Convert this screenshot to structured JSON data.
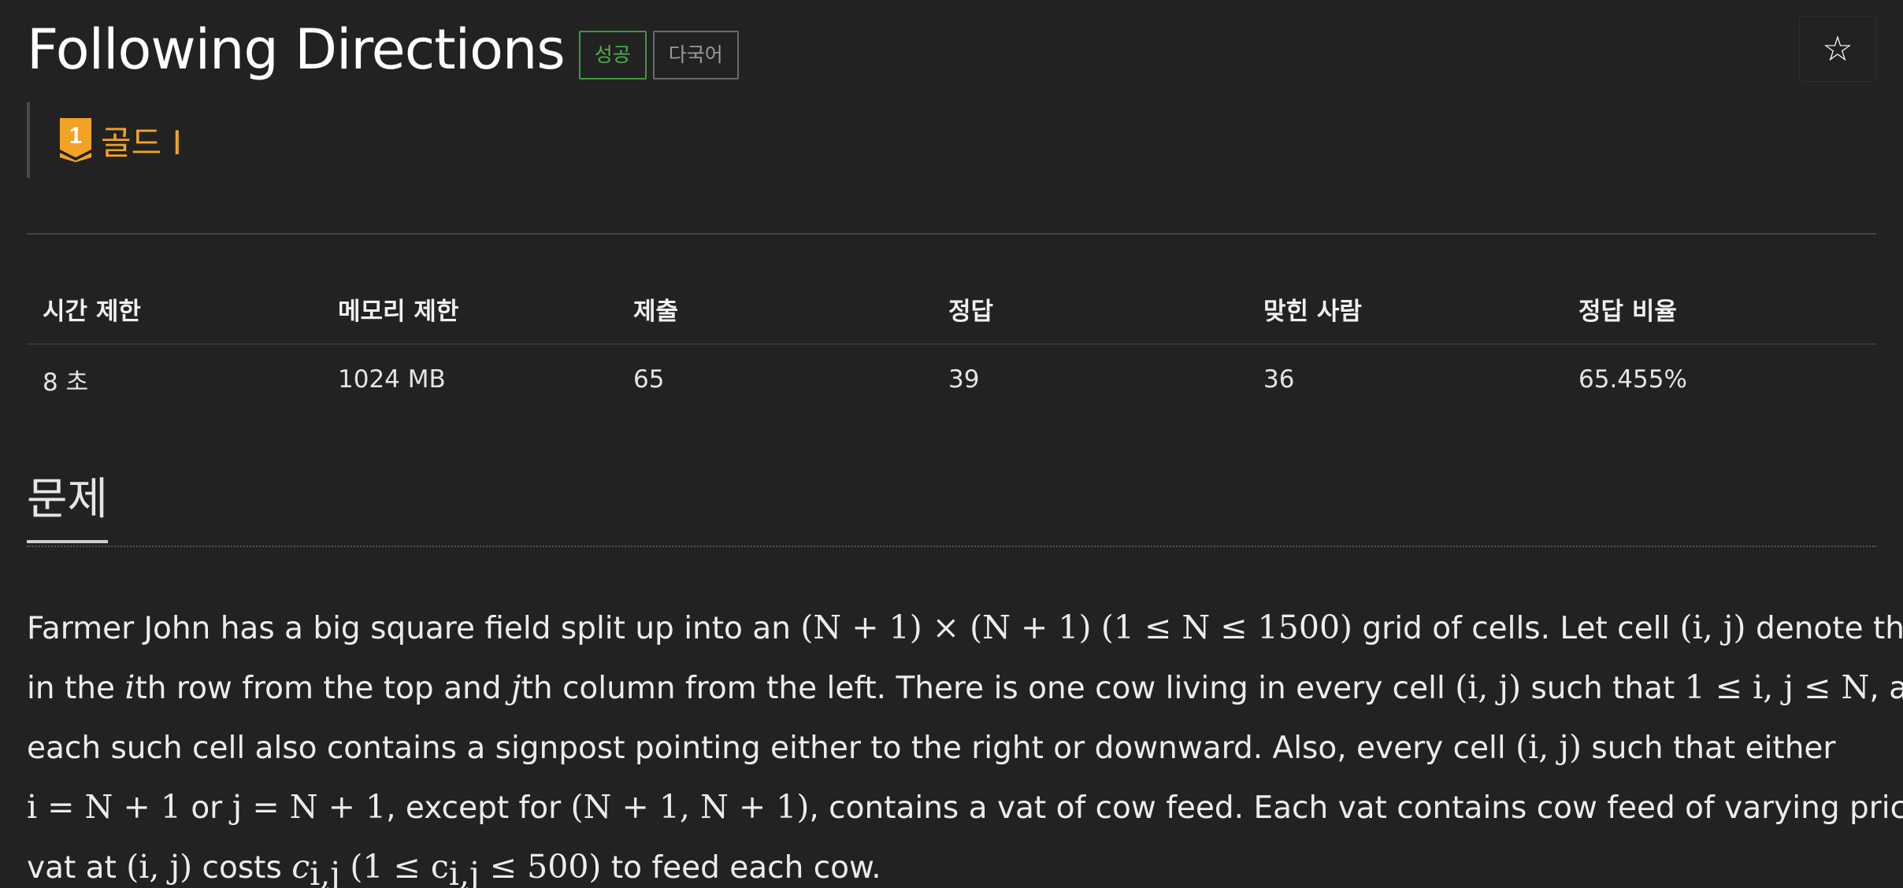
{
  "header": {
    "title": "Following Directions",
    "badges": {
      "success": "성공",
      "multilang": "다국어"
    },
    "star_icon": "star-outline-icon"
  },
  "tier": {
    "number": "1",
    "label": "골드 I",
    "color": "#f2a227"
  },
  "info_table": {
    "headers": [
      "시간 제한",
      "메모리 제한",
      "제출",
      "정답",
      "맞힌 사람",
      "정답 비율"
    ],
    "values": [
      "8 초",
      "1024 MB",
      "65",
      "39",
      "36",
      "65.455%"
    ]
  },
  "section": {
    "heading": "문제"
  },
  "problem": {
    "lines": [
      [
        "Farmer John has a big square field split up into an ",
        "(N + 1) × (N + 1)",
        " ",
        "(1 ≤ N ≤ 1500)",
        " grid of cells. Let cell ",
        "(i, j)",
        " denote the cell"
      ],
      [
        "in the ",
        "i",
        "th row from the top and ",
        "j",
        "th column from the left. There is one cow living in every cell ",
        "(i, j)",
        " such that ",
        "1 ≤ i, j ≤ N",
        ", and"
      ],
      [
        "each such cell also contains a signpost pointing either to the right or downward. Also, every cell ",
        "(i, j)",
        " such that either"
      ],
      [
        "",
        "i = N + 1",
        " or ",
        "j = N + 1",
        ", except for ",
        "(N + 1, N + 1)",
        ", contains a vat of cow feed. Each vat contains cow feed of varying price; the"
      ],
      [
        "vat at ",
        "(i, j)",
        " costs ",
        "c",
        "i,j",
        " ",
        "(1 ≤ c",
        "i,j",
        " ≤ 500)",
        " to feed each cow."
      ]
    ]
  },
  "colors": {
    "background": "#222222",
    "success": "#4cae4c",
    "gold": "#f2a227"
  }
}
